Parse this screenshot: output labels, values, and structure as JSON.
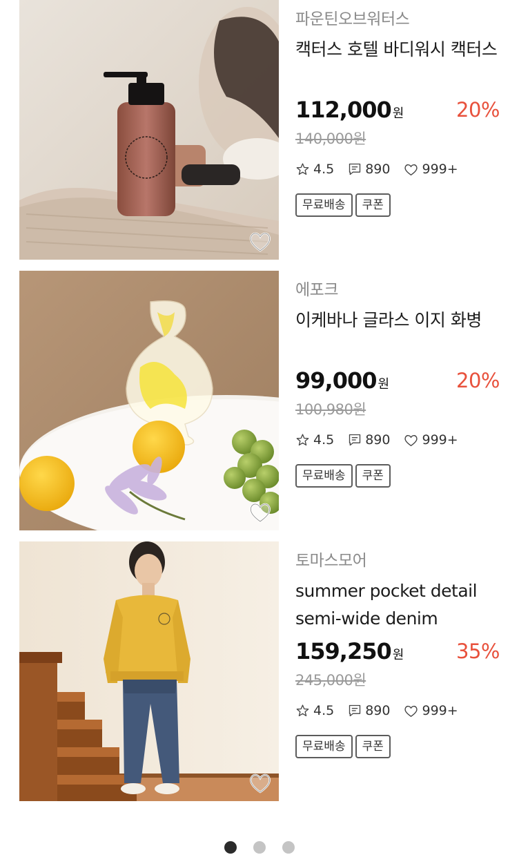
{
  "products": [
    {
      "brand": "파운틴오브워터스",
      "title": "캑터스 호텔 바디워시 캑터스",
      "price": "112,000",
      "currency": "원",
      "discount": "20%",
      "original_price": "140,000원",
      "rating": "4.5",
      "reviews": "890",
      "likes": "999+",
      "tags": [
        "무료배송",
        "쿠폰"
      ]
    },
    {
      "brand": "에포크",
      "title": "이케바나 글라스 이지 화병",
      "price": "99,000",
      "currency": "원",
      "discount": "20%",
      "original_price": "100,980원",
      "rating": "4.5",
      "reviews": "890",
      "likes": "999+",
      "tags": [
        "무료배송",
        "쿠폰"
      ]
    },
    {
      "brand": "토마스모어",
      "title": "summer pocket detail semi-wide denim",
      "price": "159,250",
      "currency": "원",
      "discount": "35%",
      "original_price": "245,000원",
      "rating": "4.5",
      "reviews": "890",
      "likes": "999+",
      "tags": [
        "무료배송",
        "쿠폰"
      ]
    }
  ],
  "pagination": {
    "total": 3,
    "active": 1
  },
  "icons": {
    "rating": "star-outline-icon",
    "reviews": "comment-icon",
    "likes": "heart-outline-icon",
    "wish": "heart-overlay-icon"
  },
  "colors": {
    "discount": "#e8513c",
    "dot_active": "#2b2b2b",
    "dot_inactive": "#c4c4c4"
  }
}
